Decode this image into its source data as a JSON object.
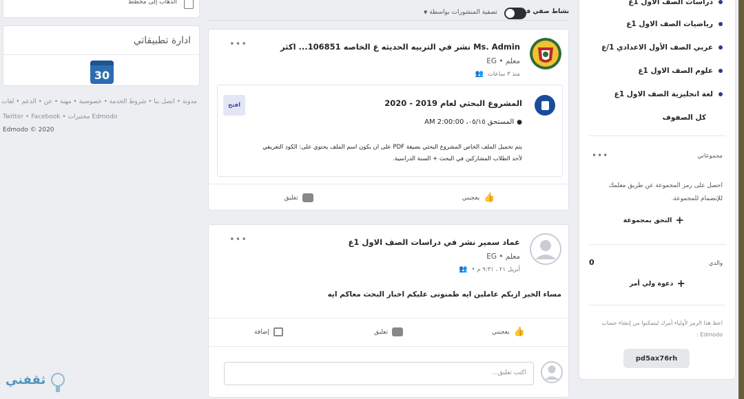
{
  "left": {
    "top_item": "الذهاب إلى مخطط",
    "apps_title": "ادارة تطبيقاتي",
    "calendar_day": "30",
    "footer_line1": "مدونة • اتصل بنا • شروط الخدمة • خصوصية • مهنة • عن • الدعم • لغات",
    "footer_line2": "Twitter • Facebook • مختبرات Edmodo",
    "copyright": "Edmodo © 2020"
  },
  "filter_bar": {
    "toggle_label": "نشاط صفي فقط",
    "filter_label": "تصفية المنشورات بواسطة"
  },
  "post1": {
    "author": "Ms. Admin نشر في التربيه الحديثه ع الخاصه 106851... اكثر",
    "role": "معلم • EG",
    "time": "منذ ٣ ساعات",
    "assignment": {
      "title": "المشروع البحثي لعام 2019 - 2020",
      "due": "المستحق ٠٥/١٥، 2:00:00 AM",
      "description": "يتم تحميل الملف الخاص المشروع البحثي بصيغة PDF على ان يكون اسم الملف يحتوي على: الكود التعريفي لأحد الطلاب المشاركين في البحث + السنة الدراسية.",
      "open_label": "افتح"
    },
    "like_label": "يعجبني",
    "comment_label": "تعليق"
  },
  "post2": {
    "author": "عماد سمير نشر في دراسات الصف الاول 1ع",
    "role": "معلم • EG",
    "time": "أبريل ٢١ ، ٩:٣١ م •",
    "text": "مساء الخير ازيكم عاملين ايه طمنونى عليكم اخبار البحث معاكم ايه",
    "like_label": "يعجبني",
    "comment_label": "تعليق",
    "add_label": "إضافة",
    "comment_placeholder": "اكتب تعليق..."
  },
  "right": {
    "classes": [
      "دراسات الصف الاول 1ع",
      "رياضيات الصف الاول 1ع",
      "عربي الصف الأول الاعدادي 1/ع",
      "علوم الصف الاول 1ع",
      "لغة انجليزية الصف الاول 1ع"
    ],
    "all_classes": "كل الصفوف",
    "groups_title": "مجموعاتي",
    "groups_desc": "احصل على رمز المجموعة عن طريق معلمك للإنضمام للمجموعة.",
    "join_group": "التحق بمجموعة",
    "parents_title": "والدي",
    "parents_count": "0",
    "invite_parent": "دعوة ولي أمر",
    "parent_code_desc": "اعط هذا الرمز لأولياء أمرك ليتمكنوا من إنشاء حساب Edmodo :",
    "parent_code": "pd5ax76rh"
  },
  "watermark_text": "ثقفني"
}
